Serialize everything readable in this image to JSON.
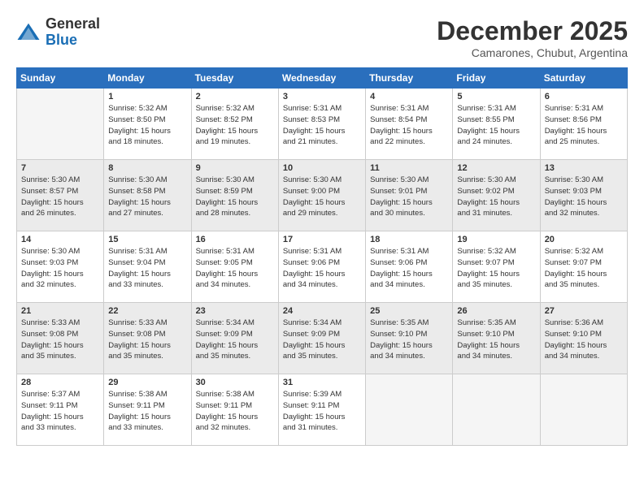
{
  "header": {
    "logo_general": "General",
    "logo_blue": "Blue",
    "month_year": "December 2025",
    "location": "Camarones, Chubut, Argentina"
  },
  "days_of_week": [
    "Sunday",
    "Monday",
    "Tuesday",
    "Wednesday",
    "Thursday",
    "Friday",
    "Saturday"
  ],
  "weeks": [
    [
      {
        "day": "",
        "content": ""
      },
      {
        "day": "1",
        "content": "Sunrise: 5:32 AM\nSunset: 8:50 PM\nDaylight: 15 hours\nand 18 minutes."
      },
      {
        "day": "2",
        "content": "Sunrise: 5:32 AM\nSunset: 8:52 PM\nDaylight: 15 hours\nand 19 minutes."
      },
      {
        "day": "3",
        "content": "Sunrise: 5:31 AM\nSunset: 8:53 PM\nDaylight: 15 hours\nand 21 minutes."
      },
      {
        "day": "4",
        "content": "Sunrise: 5:31 AM\nSunset: 8:54 PM\nDaylight: 15 hours\nand 22 minutes."
      },
      {
        "day": "5",
        "content": "Sunrise: 5:31 AM\nSunset: 8:55 PM\nDaylight: 15 hours\nand 24 minutes."
      },
      {
        "day": "6",
        "content": "Sunrise: 5:31 AM\nSunset: 8:56 PM\nDaylight: 15 hours\nand 25 minutes."
      }
    ],
    [
      {
        "day": "7",
        "content": "Sunrise: 5:30 AM\nSunset: 8:57 PM\nDaylight: 15 hours\nand 26 minutes."
      },
      {
        "day": "8",
        "content": "Sunrise: 5:30 AM\nSunset: 8:58 PM\nDaylight: 15 hours\nand 27 minutes."
      },
      {
        "day": "9",
        "content": "Sunrise: 5:30 AM\nSunset: 8:59 PM\nDaylight: 15 hours\nand 28 minutes."
      },
      {
        "day": "10",
        "content": "Sunrise: 5:30 AM\nSunset: 9:00 PM\nDaylight: 15 hours\nand 29 minutes."
      },
      {
        "day": "11",
        "content": "Sunrise: 5:30 AM\nSunset: 9:01 PM\nDaylight: 15 hours\nand 30 minutes."
      },
      {
        "day": "12",
        "content": "Sunrise: 5:30 AM\nSunset: 9:02 PM\nDaylight: 15 hours\nand 31 minutes."
      },
      {
        "day": "13",
        "content": "Sunrise: 5:30 AM\nSunset: 9:03 PM\nDaylight: 15 hours\nand 32 minutes."
      }
    ],
    [
      {
        "day": "14",
        "content": "Sunrise: 5:30 AM\nSunset: 9:03 PM\nDaylight: 15 hours\nand 32 minutes."
      },
      {
        "day": "15",
        "content": "Sunrise: 5:31 AM\nSunset: 9:04 PM\nDaylight: 15 hours\nand 33 minutes."
      },
      {
        "day": "16",
        "content": "Sunrise: 5:31 AM\nSunset: 9:05 PM\nDaylight: 15 hours\nand 34 minutes."
      },
      {
        "day": "17",
        "content": "Sunrise: 5:31 AM\nSunset: 9:06 PM\nDaylight: 15 hours\nand 34 minutes."
      },
      {
        "day": "18",
        "content": "Sunrise: 5:31 AM\nSunset: 9:06 PM\nDaylight: 15 hours\nand 34 minutes."
      },
      {
        "day": "19",
        "content": "Sunrise: 5:32 AM\nSunset: 9:07 PM\nDaylight: 15 hours\nand 35 minutes."
      },
      {
        "day": "20",
        "content": "Sunrise: 5:32 AM\nSunset: 9:07 PM\nDaylight: 15 hours\nand 35 minutes."
      }
    ],
    [
      {
        "day": "21",
        "content": "Sunrise: 5:33 AM\nSunset: 9:08 PM\nDaylight: 15 hours\nand 35 minutes."
      },
      {
        "day": "22",
        "content": "Sunrise: 5:33 AM\nSunset: 9:08 PM\nDaylight: 15 hours\nand 35 minutes."
      },
      {
        "day": "23",
        "content": "Sunrise: 5:34 AM\nSunset: 9:09 PM\nDaylight: 15 hours\nand 35 minutes."
      },
      {
        "day": "24",
        "content": "Sunrise: 5:34 AM\nSunset: 9:09 PM\nDaylight: 15 hours\nand 35 minutes."
      },
      {
        "day": "25",
        "content": "Sunrise: 5:35 AM\nSunset: 9:10 PM\nDaylight: 15 hours\nand 34 minutes."
      },
      {
        "day": "26",
        "content": "Sunrise: 5:35 AM\nSunset: 9:10 PM\nDaylight: 15 hours\nand 34 minutes."
      },
      {
        "day": "27",
        "content": "Sunrise: 5:36 AM\nSunset: 9:10 PM\nDaylight: 15 hours\nand 34 minutes."
      }
    ],
    [
      {
        "day": "28",
        "content": "Sunrise: 5:37 AM\nSunset: 9:11 PM\nDaylight: 15 hours\nand 33 minutes."
      },
      {
        "day": "29",
        "content": "Sunrise: 5:38 AM\nSunset: 9:11 PM\nDaylight: 15 hours\nand 33 minutes."
      },
      {
        "day": "30",
        "content": "Sunrise: 5:38 AM\nSunset: 9:11 PM\nDaylight: 15 hours\nand 32 minutes."
      },
      {
        "day": "31",
        "content": "Sunrise: 5:39 AM\nSunset: 9:11 PM\nDaylight: 15 hours\nand 31 minutes."
      },
      {
        "day": "",
        "content": ""
      },
      {
        "day": "",
        "content": ""
      },
      {
        "day": "",
        "content": ""
      }
    ]
  ]
}
